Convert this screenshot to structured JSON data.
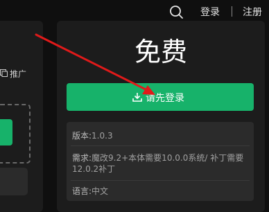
{
  "header": {
    "login_label": "登录",
    "register_label": "注册",
    "search_icon": "search-icon"
  },
  "left_panel": {
    "promo_label": "推广",
    "promo_icon": "share-icon"
  },
  "product": {
    "price_label": "免费",
    "login_button_label": "请先登录",
    "login_button_icon": "download-icon",
    "info": [
      {
        "key": "版本:",
        "value": "1.0.3"
      },
      {
        "key": "需求:",
        "value": "魔改9.2+本体需要10.0.0系统/ 补丁需要12.0.2补丁"
      },
      {
        "key": "语言:",
        "value": "中文"
      }
    ]
  },
  "annotation": {
    "arrow_color": "#e11a1a"
  },
  "colors": {
    "accent": "#17b26a",
    "panel": "#1c1c1c",
    "background": "#0f0f0f"
  }
}
